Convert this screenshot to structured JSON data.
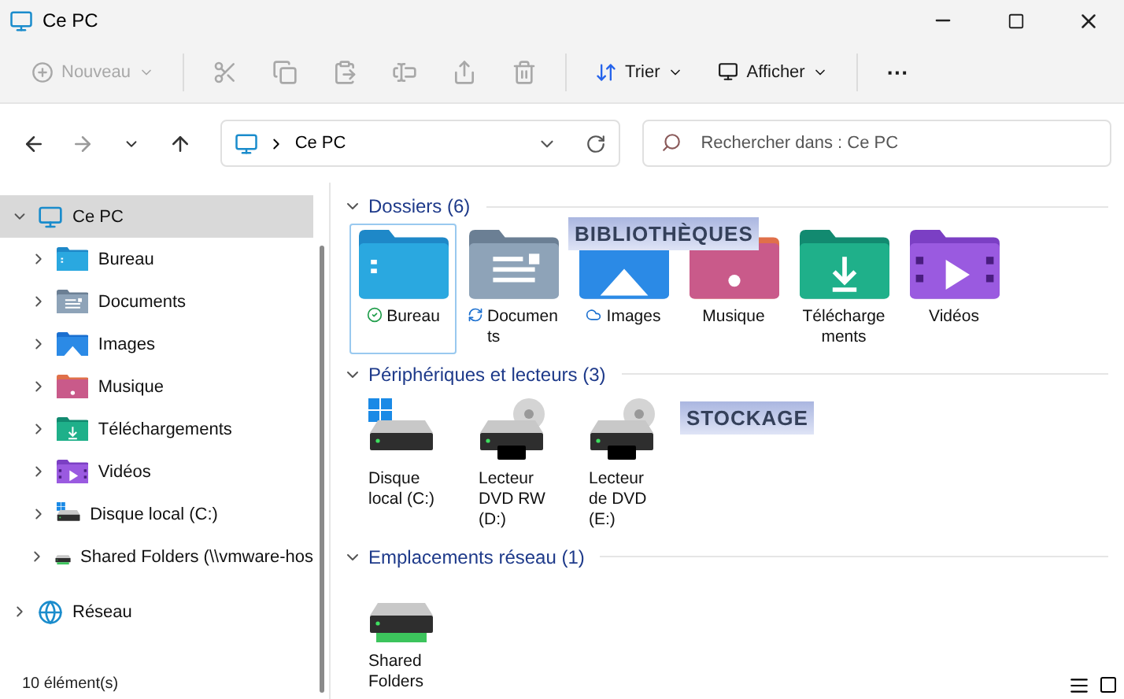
{
  "window": {
    "title": "Ce PC"
  },
  "toolbar": [
    {
      "kind": "new",
      "label": "Nouveau",
      "disabled": true
    },
    {
      "kind": "cut",
      "disabled": true
    },
    {
      "kind": "copy",
      "disabled": true
    },
    {
      "kind": "paste",
      "disabled": true
    },
    {
      "kind": "rename",
      "disabled": true
    },
    {
      "kind": "share",
      "disabled": true
    },
    {
      "kind": "delete",
      "disabled": true
    },
    {
      "kind": "sort",
      "label": "Trier",
      "disabled": false
    },
    {
      "kind": "view",
      "label": "Afficher",
      "disabled": false
    },
    {
      "kind": "more",
      "label": "···",
      "disabled": false
    }
  ],
  "address": {
    "path": "Ce PC"
  },
  "search": {
    "placeholder": "Rechercher dans : Ce PC"
  },
  "sidebar": {
    "items": [
      {
        "label": "Ce PC",
        "kind": "pc",
        "expanded": true,
        "selected": true,
        "children": [
          {
            "label": "Bureau",
            "kind": "desktop",
            "expanded": false,
            "selected": false
          },
          {
            "label": "Documents",
            "kind": "documents",
            "expanded": false,
            "selected": false
          },
          {
            "label": "Images",
            "kind": "pictures",
            "expanded": false,
            "selected": false
          },
          {
            "label": "Musique",
            "kind": "music",
            "expanded": false,
            "selected": false
          },
          {
            "label": "Téléchargements",
            "kind": "downloads",
            "expanded": false,
            "selected": false
          },
          {
            "label": "Vidéos",
            "kind": "videos",
            "expanded": false,
            "selected": false
          },
          {
            "label": "Disque local (C:)",
            "kind": "system",
            "expanded": false,
            "selected": false
          },
          {
            "label": "Shared Folders (\\\\vmware-hos",
            "kind": "network",
            "expanded": false,
            "selected": false
          }
        ]
      },
      {
        "label": "Réseau",
        "kind": "lan",
        "expanded": false,
        "selected": false
      }
    ]
  },
  "status_bar": {
    "count": "10 élément(s)"
  },
  "sections": [
    {
      "title": "Dossiers (6)",
      "expanded": true,
      "overlay": "BIBLIOTHÈQUES",
      "items": [
        {
          "label": "Bureau",
          "kind": "desktop",
          "badge": {
            "kind": "synced"
          },
          "selected": true
        },
        {
          "label": "Documents",
          "kind": "documents",
          "badge": {
            "kind": "syncing"
          },
          "selected": false
        },
        {
          "label": "Images",
          "kind": "pictures",
          "badge": {
            "kind": "cloud"
          },
          "selected": false
        },
        {
          "label": "Musique",
          "kind": "music",
          "selected": false
        },
        {
          "label": "Téléchargements",
          "kind": "downloads",
          "selected": false
        },
        {
          "label": "Vidéos",
          "kind": "videos",
          "selected": false
        }
      ]
    },
    {
      "title": "Périphériques et lecteurs (3)",
      "expanded": true,
      "overlay": "STOCKAGE",
      "items": [
        {
          "label": "Disque local (C:)",
          "kind": "system",
          "selected": false
        },
        {
          "label": "Lecteur DVD RW (D:)",
          "kind": "dvd",
          "selected": false
        },
        {
          "label": "Lecteur de DVD (E:)",
          "kind": "dvd",
          "selected": false
        }
      ]
    },
    {
      "title": "Emplacements réseau (1)",
      "expanded": true,
      "items": [
        {
          "label": "Shared Folders",
          "kind": "network",
          "selected": false
        }
      ]
    }
  ]
}
